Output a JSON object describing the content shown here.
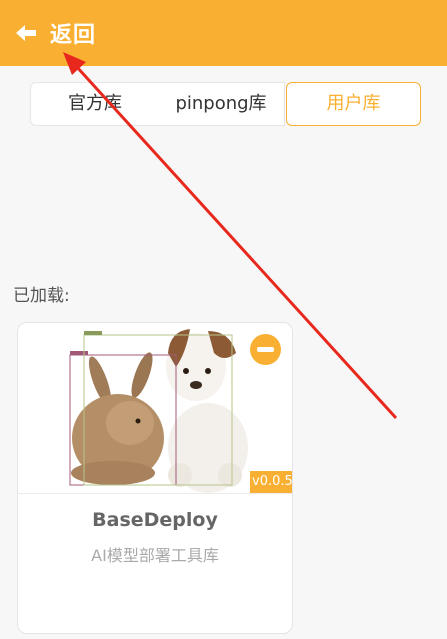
{
  "header": {
    "back_label": "返回",
    "back_icon": "arrow-left-icon"
  },
  "tabs": [
    {
      "label": "官方库",
      "active": false
    },
    {
      "label": "pinpong库",
      "active": false
    },
    {
      "label": "用户库",
      "active": true
    }
  ],
  "loaded_label": "已加载:",
  "library_card": {
    "image": "rabbit-and-puppy-detection-photo",
    "version": "v0.0.5",
    "title": "BaseDeploy",
    "description": "AI模型部署工具库",
    "remove_icon": "minus-circle-icon"
  },
  "colors": {
    "accent": "#f9b032",
    "annotation_arrow": "#e8281c"
  }
}
